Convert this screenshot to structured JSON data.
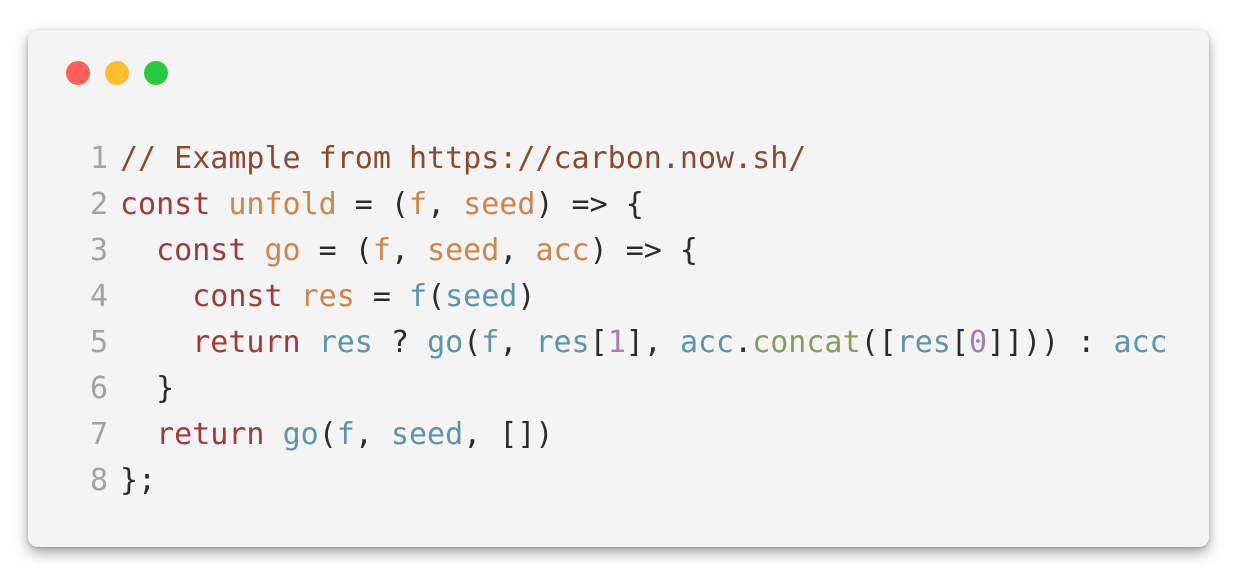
{
  "window": {
    "controls": [
      {
        "name": "close",
        "color": "#ff5f57"
      },
      {
        "name": "minimize",
        "color": "#febc2e"
      },
      {
        "name": "zoom",
        "color": "#28c840"
      }
    ]
  },
  "colors": {
    "comment": "#8a4a2e",
    "keyword": "#9e3a3a",
    "variable": "#cf8549",
    "call": "#5a94ad",
    "method": "#81a05a",
    "number": "#a57bbe",
    "punct": "#2b2b2b",
    "line_number": "#a3a3a3",
    "background": "#f4f4f4"
  },
  "code": {
    "lines": [
      {
        "number": "1",
        "tokens": [
          {
            "t": "// Example from https://carbon.now.sh/",
            "c": "comment"
          }
        ]
      },
      {
        "number": "2",
        "tokens": [
          {
            "t": "const",
            "c": "keyword"
          },
          {
            "t": " ",
            "c": "punct"
          },
          {
            "t": "unfold",
            "c": "variable"
          },
          {
            "t": " = (",
            "c": "punct"
          },
          {
            "t": "f",
            "c": "variable"
          },
          {
            "t": ", ",
            "c": "punct"
          },
          {
            "t": "seed",
            "c": "variable"
          },
          {
            "t": ") => {",
            "c": "punct"
          }
        ]
      },
      {
        "number": "3",
        "tokens": [
          {
            "t": "  ",
            "c": "punct"
          },
          {
            "t": "const",
            "c": "keyword"
          },
          {
            "t": " ",
            "c": "punct"
          },
          {
            "t": "go",
            "c": "variable"
          },
          {
            "t": " = (",
            "c": "punct"
          },
          {
            "t": "f",
            "c": "variable"
          },
          {
            "t": ", ",
            "c": "punct"
          },
          {
            "t": "seed",
            "c": "variable"
          },
          {
            "t": ", ",
            "c": "punct"
          },
          {
            "t": "acc",
            "c": "variable"
          },
          {
            "t": ") => {",
            "c": "punct"
          }
        ]
      },
      {
        "number": "4",
        "tokens": [
          {
            "t": "    ",
            "c": "punct"
          },
          {
            "t": "const",
            "c": "keyword"
          },
          {
            "t": " ",
            "c": "punct"
          },
          {
            "t": "res",
            "c": "variable"
          },
          {
            "t": " = ",
            "c": "punct"
          },
          {
            "t": "f",
            "c": "call"
          },
          {
            "t": "(",
            "c": "punct"
          },
          {
            "t": "seed",
            "c": "call"
          },
          {
            "t": ")",
            "c": "punct"
          }
        ]
      },
      {
        "number": "5",
        "tokens": [
          {
            "t": "    ",
            "c": "punct"
          },
          {
            "t": "return",
            "c": "keyword"
          },
          {
            "t": " ",
            "c": "punct"
          },
          {
            "t": "res",
            "c": "call"
          },
          {
            "t": " ? ",
            "c": "punct"
          },
          {
            "t": "go",
            "c": "call"
          },
          {
            "t": "(",
            "c": "punct"
          },
          {
            "t": "f",
            "c": "call"
          },
          {
            "t": ", ",
            "c": "punct"
          },
          {
            "t": "res",
            "c": "call"
          },
          {
            "t": "[",
            "c": "punct"
          },
          {
            "t": "1",
            "c": "number"
          },
          {
            "t": "], ",
            "c": "punct"
          },
          {
            "t": "acc",
            "c": "call"
          },
          {
            "t": ".",
            "c": "punct"
          },
          {
            "t": "concat",
            "c": "method"
          },
          {
            "t": "([",
            "c": "punct"
          },
          {
            "t": "res",
            "c": "call"
          },
          {
            "t": "[",
            "c": "punct"
          },
          {
            "t": "0",
            "c": "number"
          },
          {
            "t": "]])) : ",
            "c": "punct"
          },
          {
            "t": "acc",
            "c": "call"
          }
        ]
      },
      {
        "number": "6",
        "tokens": [
          {
            "t": "  }",
            "c": "punct"
          }
        ]
      },
      {
        "number": "7",
        "tokens": [
          {
            "t": "  ",
            "c": "punct"
          },
          {
            "t": "return",
            "c": "keyword"
          },
          {
            "t": " ",
            "c": "punct"
          },
          {
            "t": "go",
            "c": "call"
          },
          {
            "t": "(",
            "c": "punct"
          },
          {
            "t": "f",
            "c": "call"
          },
          {
            "t": ", ",
            "c": "punct"
          },
          {
            "t": "seed",
            "c": "call"
          },
          {
            "t": ", [])",
            "c": "punct"
          }
        ]
      },
      {
        "number": "8",
        "tokens": [
          {
            "t": "};",
            "c": "punct"
          }
        ]
      }
    ]
  }
}
